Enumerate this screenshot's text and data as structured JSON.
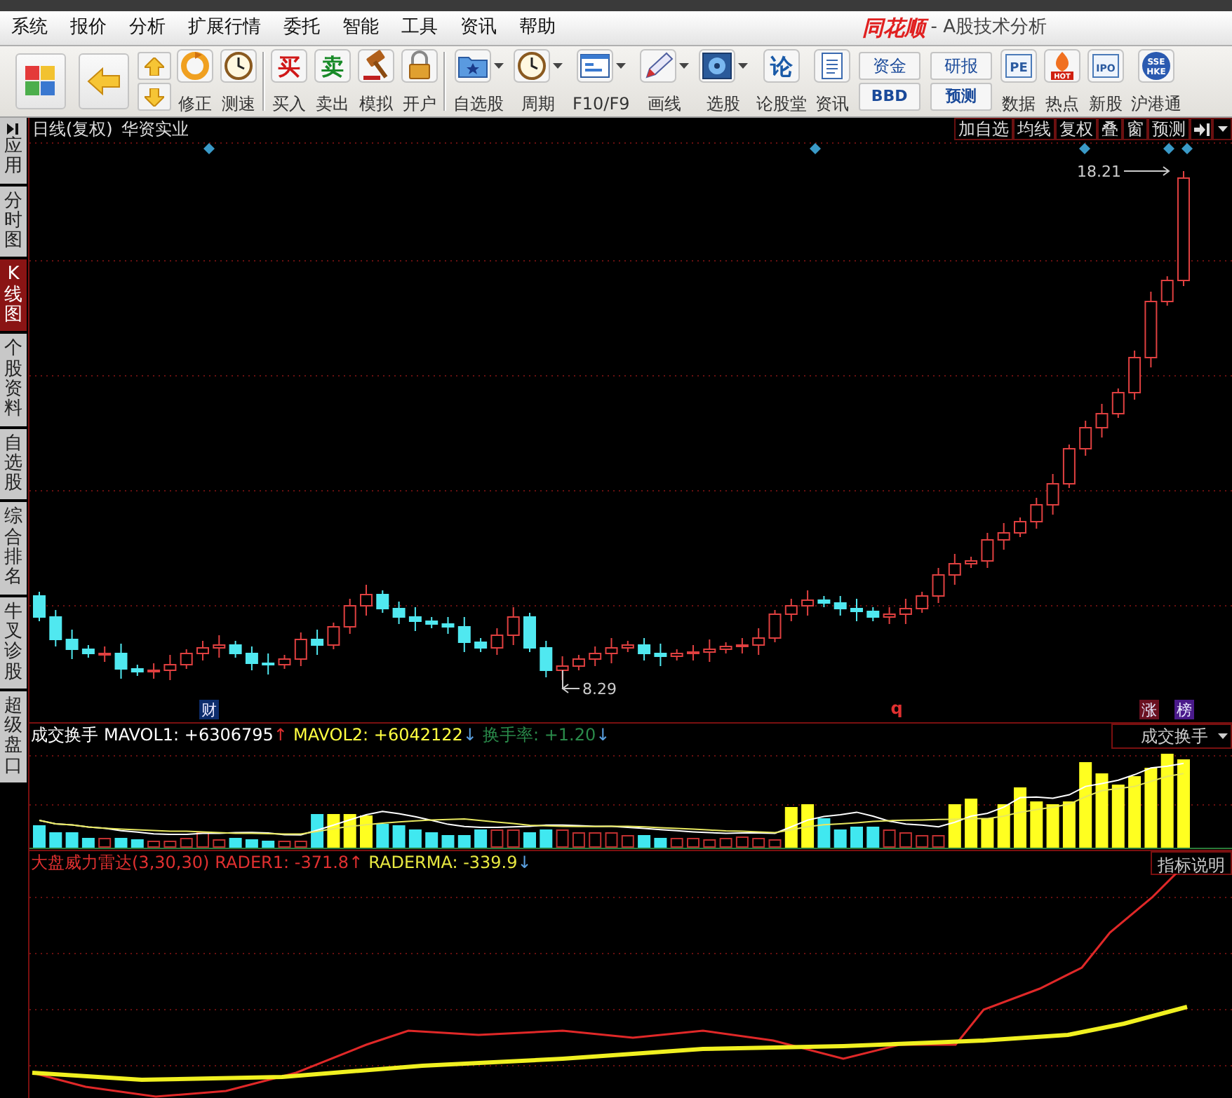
{
  "menu": [
    {
      "label": "系统"
    },
    {
      "label": "报价"
    },
    {
      "label": "分析"
    },
    {
      "label": "扩展行情"
    },
    {
      "label": "委托"
    },
    {
      "label": "智能"
    },
    {
      "label": "工具"
    },
    {
      "label": "资讯"
    },
    {
      "label": "帮助"
    }
  ],
  "app_title": {
    "brand": "同花顺",
    "subtitle": "- A股技术分析"
  },
  "toolbar": [
    [
      {
        "kind": "icon"
      },
      {
        "kind": "icon"
      },
      {
        "kind": "updown"
      },
      {
        "kind": "button",
        "label": "修正"
      },
      {
        "kind": "button",
        "label": "测速"
      }
    ],
    [
      {
        "kind": "button",
        "glyph": "买",
        "color": "#d01818",
        "label": "买入"
      },
      {
        "kind": "button",
        "glyph": "卖",
        "color": "#188a28",
        "label": "卖出"
      },
      {
        "kind": "button",
        "label": "模拟"
      },
      {
        "kind": "button",
        "label": "开户"
      }
    ],
    [
      {
        "kind": "dropdown",
        "label": "自选股"
      },
      {
        "kind": "dropdown",
        "label": "周期"
      },
      {
        "kind": "dropdown",
        "label": "F10/F9"
      },
      {
        "kind": "dropdown",
        "label": "画线"
      },
      {
        "kind": "dropdown",
        "label": "选股"
      },
      {
        "kind": "button",
        "glyph": "论",
        "color": "#1a5aa8",
        "label": "论股堂"
      },
      {
        "kind": "button",
        "label": "资讯"
      },
      {
        "kind": "pair",
        "top": "资金",
        "bottom": "BBD"
      },
      {
        "kind": "pair",
        "top": "研报",
        "bottom": "预测"
      },
      {
        "kind": "button",
        "glyph": "PE",
        "label": "数据"
      },
      {
        "kind": "button",
        "glyph": "HOT",
        "label": "热点"
      },
      {
        "kind": "button",
        "glyph": "IPO",
        "label": "新股"
      },
      {
        "kind": "button",
        "glyph": "SSE HKE",
        "label": "沪港通"
      }
    ]
  ],
  "sidebar": [
    {
      "label": "应用",
      "kind": "collapse",
      "selected": false
    },
    {
      "label": "分时图",
      "kind": "tab",
      "selected": false
    },
    {
      "label": "K线图",
      "kind": "tab",
      "selected": true
    },
    {
      "label": "个股资料",
      "kind": "tab",
      "selected": false
    },
    {
      "label": "自选股",
      "kind": "tab",
      "selected": false
    },
    {
      "label": "综合排名",
      "kind": "tab",
      "selected": false
    },
    {
      "label": "牛叉诊股",
      "kind": "tab",
      "selected": false
    },
    {
      "label": "超级盘口",
      "kind": "tab",
      "selected": false
    }
  ],
  "chart_header": {
    "period": "日线(复权)",
    "stock": "华资实业",
    "buttons": [
      "加自选",
      "均线",
      "复权",
      "叠",
      "窗",
      "预测"
    ]
  },
  "price_chart": {
    "high_label": "18.21",
    "low_label": "8.29",
    "markers": [
      {
        "text": "财",
        "kind": "tag",
        "color": "#0c2c6c"
      },
      {
        "text": "q",
        "kind": "letter",
        "color": "#e03030"
      },
      {
        "text": "涨",
        "kind": "tag",
        "color": "#6a1020"
      },
      {
        "text": "榜",
        "kind": "tag",
        "color": "#4a1a8a"
      }
    ]
  },
  "volume_panel": {
    "legend": [
      {
        "text": "成交换手",
        "color": "#ffffff"
      },
      {
        "text": "MAVOL1: +6306795",
        "color": "#ffffff",
        "arrow": {
          "text": "↑",
          "color": "#e03030"
        }
      },
      {
        "text": "MAVOL2: +6042122",
        "color": "#ffff40",
        "arrow": {
          "text": "↓",
          "color": "#5aa0e0"
        }
      },
      {
        "text": "换手率: +1.20",
        "color": "#2a8a4a",
        "arrow": {
          "text": "↓",
          "color": "#5aa0e0"
        }
      }
    ],
    "selector": "成交换手"
  },
  "indicator_panel": {
    "legend": [
      {
        "text": "大盘威力雷达(3,30,30)",
        "color": "#e03030"
      },
      {
        "text": "RADER1: -371.8",
        "color": "#e03030",
        "arrow": {
          "text": "↑",
          "color": "#e03030"
        }
      },
      {
        "text": "RADERMA: -339.9",
        "color": "#e8e840",
        "arrow": {
          "text": "↓",
          "color": "#5aa0e0"
        }
      }
    ],
    "button": "指标说明"
  }
}
